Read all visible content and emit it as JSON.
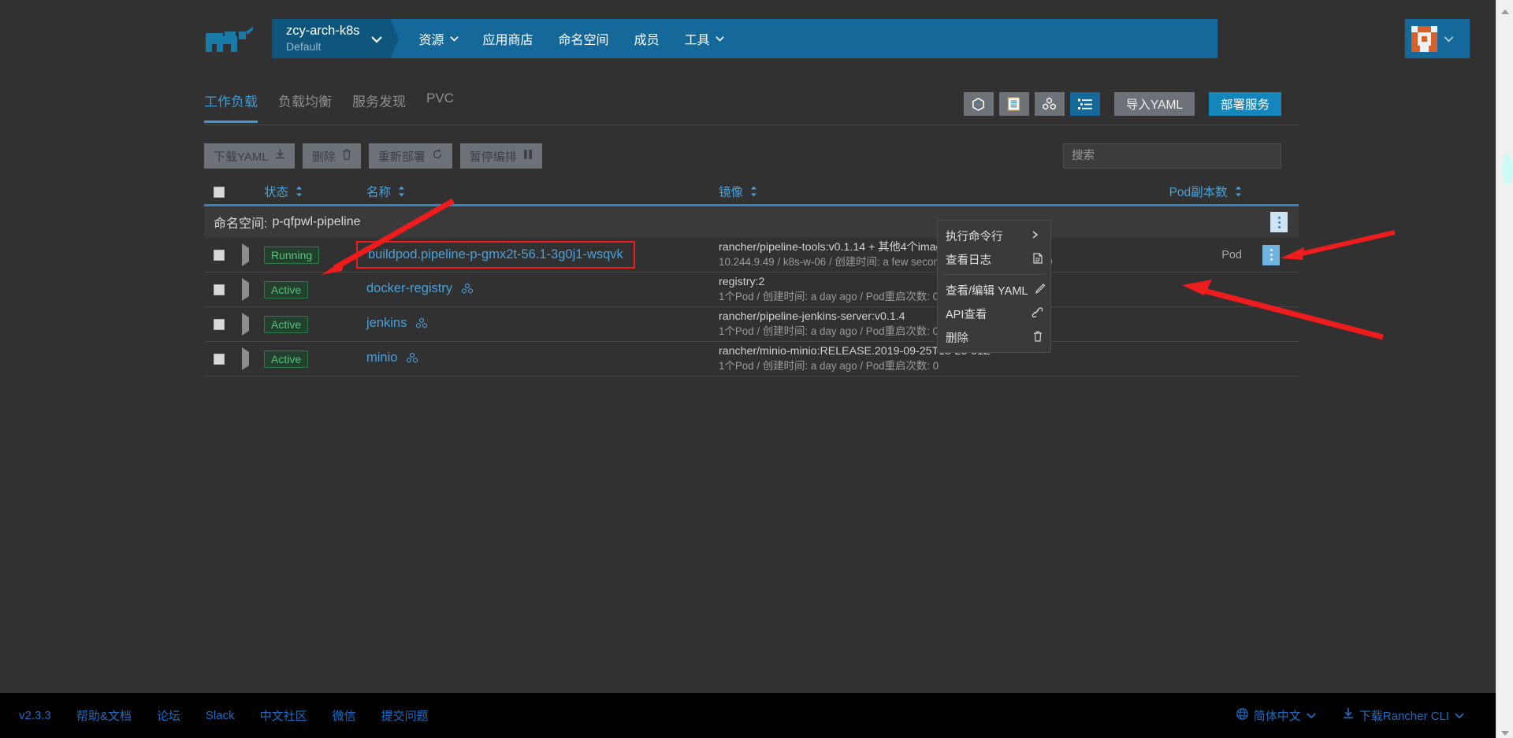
{
  "header": {
    "logo_name": "rancher-cow-logo",
    "project": {
      "name": "zcy-arch-k8s",
      "subtitle": "Default"
    },
    "nav": [
      {
        "label": "资源",
        "has_caret": true
      },
      {
        "label": "应用商店",
        "has_caret": false
      },
      {
        "label": "命名空间",
        "has_caret": false
      },
      {
        "label": "成员",
        "has_caret": false
      },
      {
        "label": "工具",
        "has_caret": true
      }
    ],
    "user_menu_label": ""
  },
  "tabs": [
    {
      "label": "工作负载",
      "active": true
    },
    {
      "label": "负载均衡",
      "active": false
    },
    {
      "label": "服务发现",
      "active": false
    },
    {
      "label": "PVC",
      "active": false
    }
  ],
  "view_toolbar": {
    "icons": [
      {
        "name": "cluster-view-icon",
        "active": false
      },
      {
        "name": "list-view-icon",
        "active": false
      },
      {
        "name": "pod-group-view-icon",
        "active": false
      },
      {
        "name": "detail-list-view-icon",
        "active": true
      }
    ],
    "import_yaml_label": "导入YAML",
    "deploy_label": "部署服务"
  },
  "actions": [
    {
      "label": "下载YAML",
      "icon": "download-icon"
    },
    {
      "label": "删除",
      "icon": "trash-icon"
    },
    {
      "label": "重新部署",
      "icon": "redeploy-icon"
    },
    {
      "label": "暂停编排",
      "icon": "pause-icon"
    }
  ],
  "search": {
    "value": "",
    "placeholder": "搜索"
  },
  "table": {
    "columns": [
      {
        "key": "state",
        "label": "状态",
        "sortable": true
      },
      {
        "key": "name",
        "label": "名称",
        "sortable": true
      },
      {
        "key": "image",
        "label": "镜像",
        "sortable": true
      },
      {
        "key": "scale",
        "label": "Pod副本数",
        "sortable": true
      }
    ],
    "group_label": "命名空间:",
    "group_value": "p-qfpwl-pipeline",
    "rows": [
      {
        "state": "Running",
        "state_kind": "running",
        "name": "buildpod.pipeline-p-gmx2t-56.1-3g0j1-wsqvk",
        "name_highlighted": true,
        "has_pod_icon": false,
        "image": "rancher/pipeline-tools:v0.1.14 + 其他4个images",
        "image_sub": "10.244.9.49 / k8s-w-06 / 创建时间: a few seconds ago / Pod重启次数: 0",
        "scale": "Pod"
      },
      {
        "state": "Active",
        "state_kind": "active",
        "name": "docker-registry",
        "name_highlighted": false,
        "has_pod_icon": true,
        "image": "registry:2",
        "image_sub": "1个Pod / 创建时间: a day ago / Pod重启次数: 0",
        "scale": ""
      },
      {
        "state": "Active",
        "state_kind": "active",
        "name": "jenkins",
        "name_highlighted": false,
        "has_pod_icon": true,
        "image": "rancher/pipeline-jenkins-server:v0.1.4",
        "image_sub": "1个Pod / 创建时间: a day ago / Pod重启次数: 0",
        "scale": ""
      },
      {
        "state": "Active",
        "state_kind": "active",
        "name": "minio",
        "name_highlighted": false,
        "has_pod_icon": true,
        "image": "rancher/minio-minio:RELEASE.2019-09-25T18-25-51Z",
        "image_sub": "1个Pod / 创建时间: a day ago / Pod重启次数: 0",
        "scale": ""
      }
    ]
  },
  "context_menu": {
    "items": [
      {
        "label": "执行命令行",
        "icon": "terminal-icon",
        "separator_after": false
      },
      {
        "label": "查看日志",
        "icon": "log-file-icon",
        "separator_after": true
      },
      {
        "label": "查看/编辑 YAML",
        "icon": "pencil-icon",
        "separator_after": false
      },
      {
        "label": "API查看",
        "icon": "api-link-icon",
        "separator_after": false
      },
      {
        "label": "删除",
        "icon": "trash-icon",
        "separator_after": false
      }
    ]
  },
  "footer": {
    "left": [
      {
        "label": "v2.3.3"
      },
      {
        "label": "帮助&文档"
      },
      {
        "label": "论坛"
      },
      {
        "label": "Slack"
      },
      {
        "label": "中文社区"
      },
      {
        "label": "微信"
      },
      {
        "label": "提交问题"
      }
    ],
    "language": {
      "label": "简体中文",
      "icon": "globe-icon"
    },
    "cli": {
      "label": "下载Rancher CLI",
      "icon": "download-icon"
    }
  },
  "colors": {
    "accent": "#1486bb",
    "nav_bar": "#14699a",
    "link": "#4ba0d8",
    "shell_bg": "#313131",
    "annotation": "#ee1c1c",
    "state_active": "#51c07c"
  }
}
